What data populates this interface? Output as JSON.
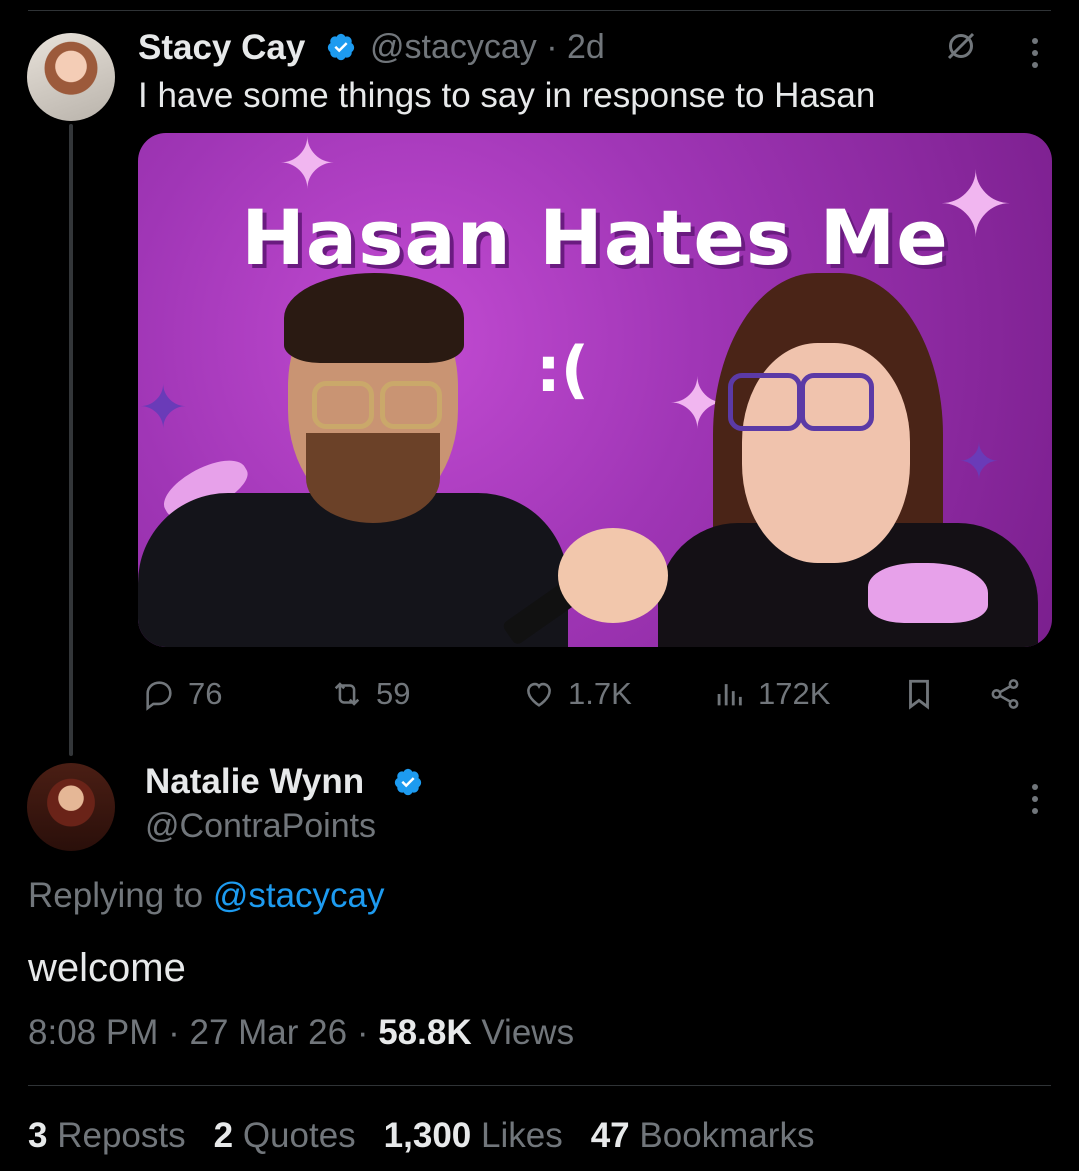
{
  "parent_tweet": {
    "author_name": "Stacy Cay",
    "handle": "@stacycay",
    "separator": "·",
    "time_ago": "2d",
    "text": "I have some things to say in response to Hasan",
    "media": {
      "title": "Hasan Hates Me",
      "subtitle": ":("
    },
    "actions": {
      "replies": "76",
      "reposts": "59",
      "likes": "1.7K",
      "views": "172K"
    }
  },
  "reply_tweet": {
    "author_name": "Natalie Wynn",
    "handle": "@ContraPoints",
    "replying_prefix": "Replying to ",
    "replying_handle": "@stacycay",
    "text": "welcome",
    "time": "8:08 PM",
    "date": "27 Mar 26",
    "views_count": "58.8K",
    "views_label": "Views",
    "stats": {
      "reposts_count": "3",
      "reposts_label": "Reposts",
      "quotes_count": "2",
      "quotes_label": "Quotes",
      "likes_count": "1,300",
      "likes_label": "Likes",
      "bookmarks_count": "47",
      "bookmarks_label": "Bookmarks"
    }
  },
  "colors": {
    "background": "#000000",
    "text_primary": "#e7e9ea",
    "text_secondary": "#71767b",
    "accent": "#1d9bf0",
    "divider": "#2f3336"
  }
}
